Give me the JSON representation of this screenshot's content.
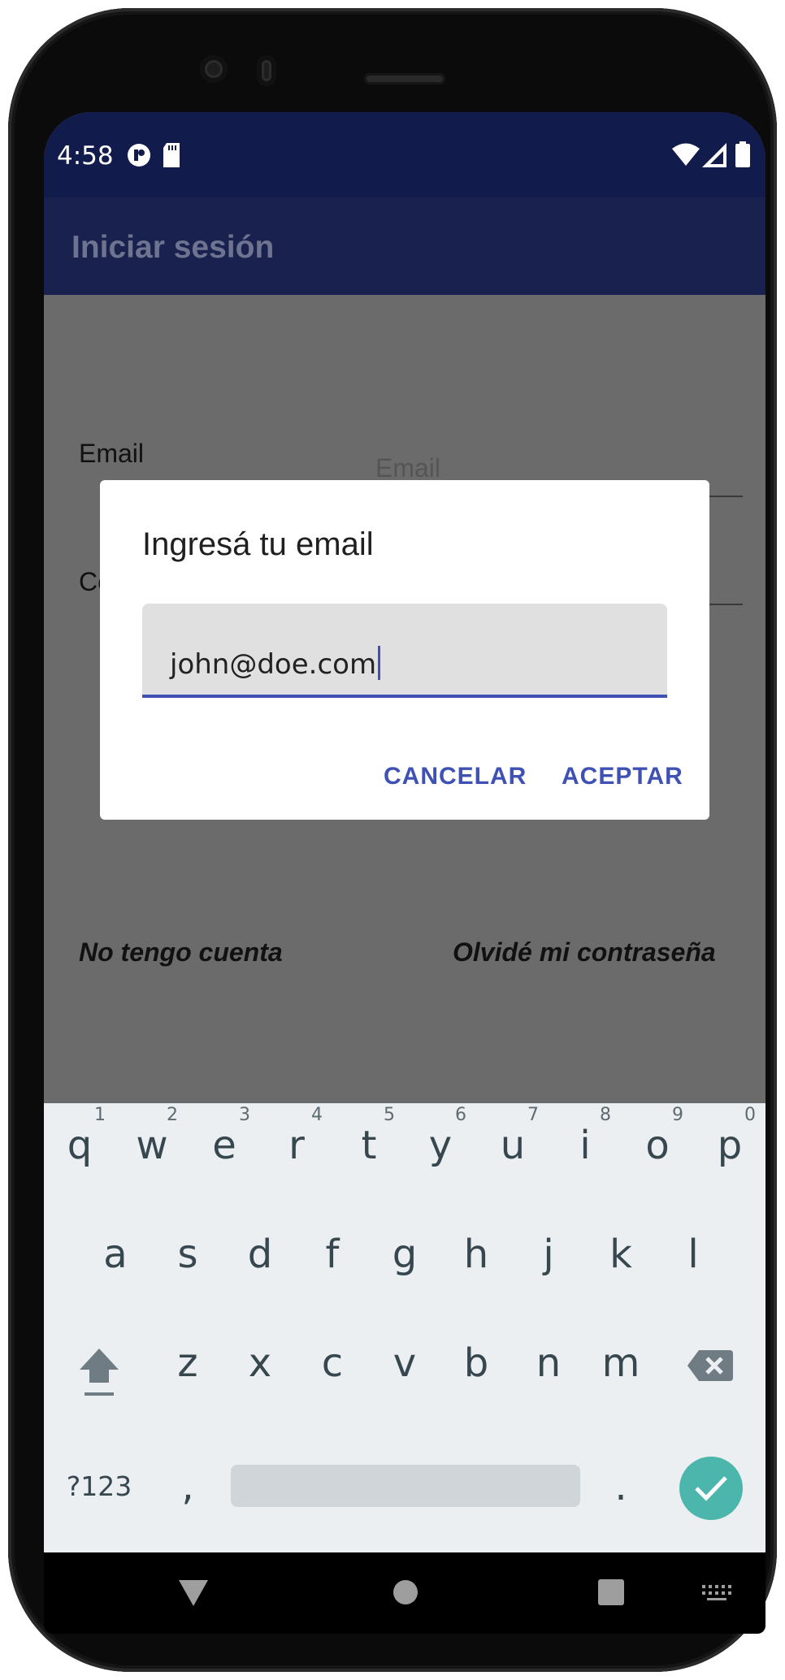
{
  "status_bar": {
    "time": "4:58"
  },
  "app_bar": {
    "title": "Iniciar sesión"
  },
  "form": {
    "email_label": "Email",
    "email_hint": "Email",
    "password_label_partial": "Co",
    "register_link": "No tengo cuenta",
    "forgot_link": "Olvidé mi contraseña"
  },
  "dialog": {
    "title": "Ingresá tu email",
    "input_value": "john@doe.com",
    "cancel_label": "CANCELAR",
    "accept_label": "ACEPTAR"
  },
  "keyboard": {
    "row1": [
      {
        "ch": "q",
        "num": "1"
      },
      {
        "ch": "w",
        "num": "2"
      },
      {
        "ch": "e",
        "num": "3"
      },
      {
        "ch": "r",
        "num": "4"
      },
      {
        "ch": "t",
        "num": "5"
      },
      {
        "ch": "y",
        "num": "6"
      },
      {
        "ch": "u",
        "num": "7"
      },
      {
        "ch": "i",
        "num": "8"
      },
      {
        "ch": "o",
        "num": "9"
      },
      {
        "ch": "p",
        "num": "0"
      }
    ],
    "row2": [
      "a",
      "s",
      "d",
      "f",
      "g",
      "h",
      "j",
      "k",
      "l"
    ],
    "row3": [
      "z",
      "x",
      "c",
      "v",
      "b",
      "n",
      "m"
    ],
    "symbols_label": "?123",
    "comma": ",",
    "period": "."
  },
  "colors": {
    "status_bar": "#111b4c",
    "app_bar": "#19214f",
    "accent": "#3f51b5",
    "enter_key": "#4db6ac",
    "scrim": "#6b6b6b"
  },
  "icons": [
    "wifi-icon",
    "signal-icon",
    "battery-icon",
    "shift-icon",
    "backspace-icon",
    "check-icon",
    "back-icon",
    "home-icon",
    "recents-icon",
    "keyboard-switch-icon"
  ]
}
